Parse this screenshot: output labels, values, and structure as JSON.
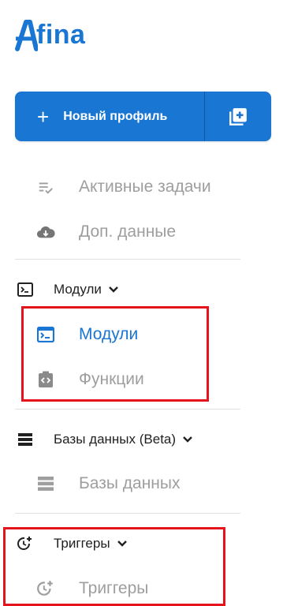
{
  "logo": {
    "text": "fina"
  },
  "new_profile": {
    "label": "Новый профиль",
    "plus": "+"
  },
  "nav": {
    "active_tasks": "Активные задачи",
    "extra_data": "Доп. данные",
    "modules_section": "Модули",
    "modules": "Модули",
    "functions": "Функции",
    "databases_section": "Базы данных (Beta)",
    "databases": "Базы данных",
    "triggers_section": "Триггеры",
    "triggers": "Триггеры"
  },
  "colors": {
    "accent": "#1976d2",
    "muted": "#9e9e9e",
    "text": "#212121",
    "highlight": "#e5131b"
  }
}
